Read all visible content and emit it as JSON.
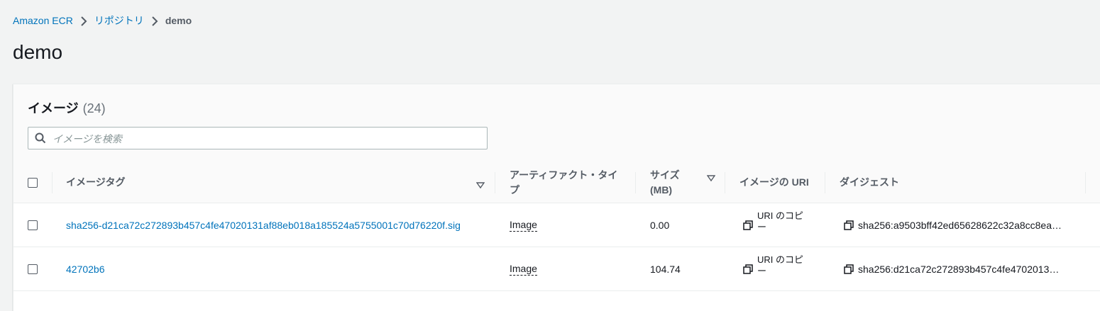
{
  "breadcrumb": {
    "root": "Amazon ECR",
    "repositories": "リポジトリ",
    "current": "demo"
  },
  "page": {
    "title": "demo"
  },
  "images_panel": {
    "title": "イメージ",
    "count": "(24)",
    "search_placeholder": "イメージを検索"
  },
  "table": {
    "columns": {
      "tag": "イメージタグ",
      "artifact_type": "アーティファクト・タイプ",
      "size": "サイズ (MB)",
      "uri": "イメージの URI",
      "digest": "ダイジェスト"
    },
    "rows": [
      {
        "tag": "sha256-d21ca72c272893b457c4fe47020131af88eb018a185524a5755001c70d76220f.sig",
        "artifact_type": "Image",
        "size": "0.00",
        "uri_copy": "URI のコピー",
        "digest": "sha256:a9503bff42ed65628622c32a8cc8ea…"
      },
      {
        "tag": "42702b6",
        "artifact_type": "Image",
        "size": "104.74",
        "uri_copy": "URI のコピー",
        "digest": "sha256:d21ca72c272893b457c4fe4702013…"
      }
    ]
  },
  "icons": {
    "separator": "chevron-right-icon",
    "search": "search-icon",
    "copy": "copy-icon",
    "sort": "sort-down-icon"
  },
  "colors": {
    "link": "#0073bb",
    "background": "#f2f3f3",
    "header_bg": "#fafafa"
  }
}
